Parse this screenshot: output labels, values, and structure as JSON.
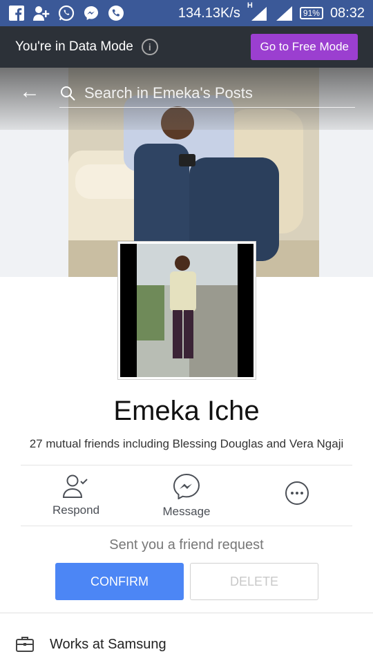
{
  "status_bar": {
    "speed": "134.13K/s",
    "network_label": "H",
    "battery": "91%",
    "time": "08:32",
    "icons": [
      "facebook-icon",
      "add-friend-icon",
      "whatsapp-icon",
      "messenger-icon",
      "phone-icon"
    ]
  },
  "data_mode": {
    "text": "You're in Data Mode",
    "info_icon": "i",
    "button_label": "Go to Free Mode",
    "button_color": "#9b3fd0"
  },
  "header": {
    "back_icon": "←",
    "search_placeholder": "Search in Emeka's Posts"
  },
  "profile": {
    "name": "Emeka Iche",
    "mutual_friends": "27 mutual friends including Blessing Douglas and Vera Ngaji"
  },
  "actions": [
    {
      "label": "Respond",
      "icon": "respond-icon"
    },
    {
      "label": "Message",
      "icon": "messenger-icon"
    },
    {
      "label": "",
      "icon": "more-icon"
    }
  ],
  "friend_request": {
    "text": "Sent you a friend request",
    "confirm_label": "CONFIRM",
    "delete_label": "DELETE",
    "confirm_color": "#4c86f5"
  },
  "about": {
    "work_text": "Works at Samsung",
    "work_icon": "briefcase-icon"
  }
}
